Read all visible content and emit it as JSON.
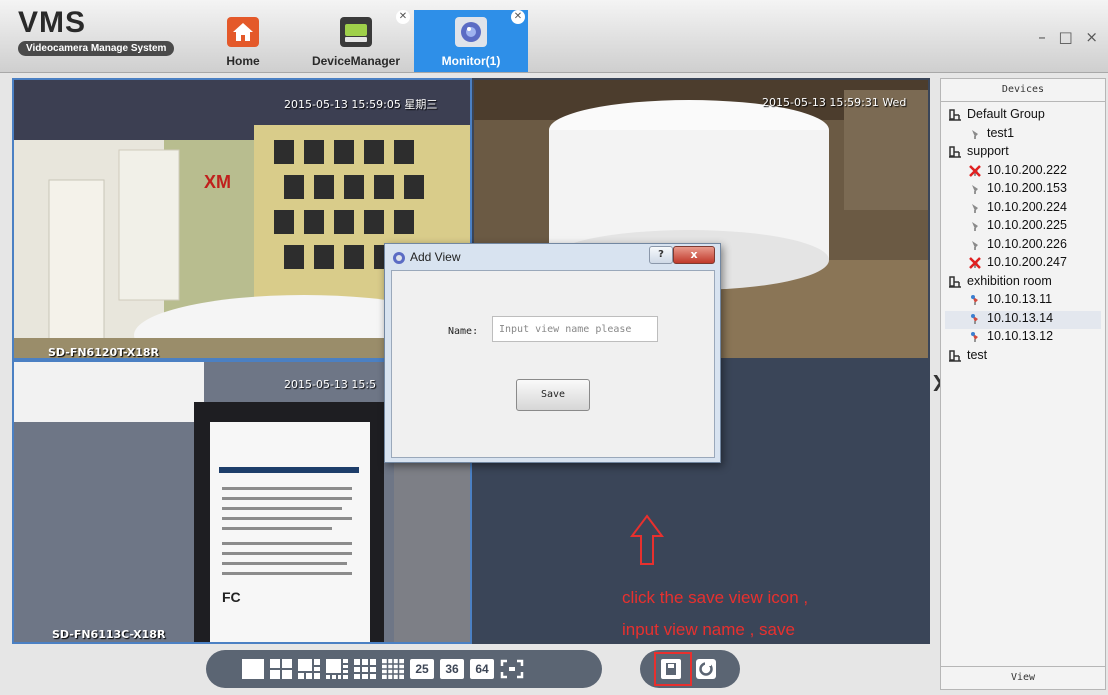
{
  "app": {
    "title": "VMS",
    "subtitle": "Videocamera Manage System",
    "window_controls": "– □ ×"
  },
  "tabs": [
    {
      "label": "Home",
      "icon": "home-icon",
      "closable": false,
      "active": false
    },
    {
      "label": "DeviceManager",
      "icon": "device-manager-icon",
      "closable": true,
      "active": false
    },
    {
      "label": "Monitor(1)",
      "icon": "monitor-icon",
      "closable": true,
      "active": true
    }
  ],
  "video_panes": [
    {
      "timestamp": "2015-05-13 15:59:05 星期三",
      "camera": "SD-FN6120T-X18R"
    },
    {
      "timestamp": "2015-05-13 15:59:31 Wed",
      "camera": ""
    },
    {
      "timestamp": "2015-05-13 15:5",
      "camera": "SD-FN6113C-X18R"
    },
    {
      "timestamp": "",
      "camera": ""
    }
  ],
  "panel": {
    "header": "Devices",
    "footer": "View",
    "tree": [
      {
        "type": "group",
        "label": "Default Group"
      },
      {
        "type": "device",
        "label": "test1",
        "status": "online"
      },
      {
        "type": "group",
        "label": "support"
      },
      {
        "type": "device",
        "label": "10.10.200.222",
        "status": "error"
      },
      {
        "type": "device",
        "label": "10.10.200.153",
        "status": "online"
      },
      {
        "type": "device",
        "label": "10.10.200.224",
        "status": "online"
      },
      {
        "type": "device",
        "label": "10.10.200.225",
        "status": "online"
      },
      {
        "type": "device",
        "label": "10.10.200.226",
        "status": "online"
      },
      {
        "type": "device",
        "label": "10.10.200.247",
        "status": "error"
      },
      {
        "type": "group",
        "label": "exhibition room"
      },
      {
        "type": "device",
        "label": "10.10.13.11",
        "status": "active"
      },
      {
        "type": "device",
        "label": "10.10.13.14",
        "status": "active",
        "selected": true
      },
      {
        "type": "device",
        "label": "10.10.13.12",
        "status": "active"
      },
      {
        "type": "group",
        "label": "test"
      }
    ]
  },
  "toolbar": {
    "layouts": [
      "1",
      "4",
      "6",
      "8",
      "9",
      "16"
    ],
    "numbers": [
      "25",
      "36",
      "64"
    ],
    "fullscreen_icon": "fullscreen-icon",
    "save_view_icon": "save-view-icon",
    "refresh_icon": "refresh-icon"
  },
  "dialog": {
    "title": "Add View",
    "help": "?",
    "close": "x",
    "name_label": "Name:",
    "name_placeholder": "Input view name please",
    "name_value": "",
    "save_label": "Save"
  },
  "annotation": {
    "line1": "click the save view icon ,",
    "line2": "input view name ,  save",
    "color": "#e8302e"
  },
  "colors": {
    "accent": "#2e8fe8",
    "grid_bg": "#3a4558",
    "toolbar_bg": "#5b6573"
  }
}
